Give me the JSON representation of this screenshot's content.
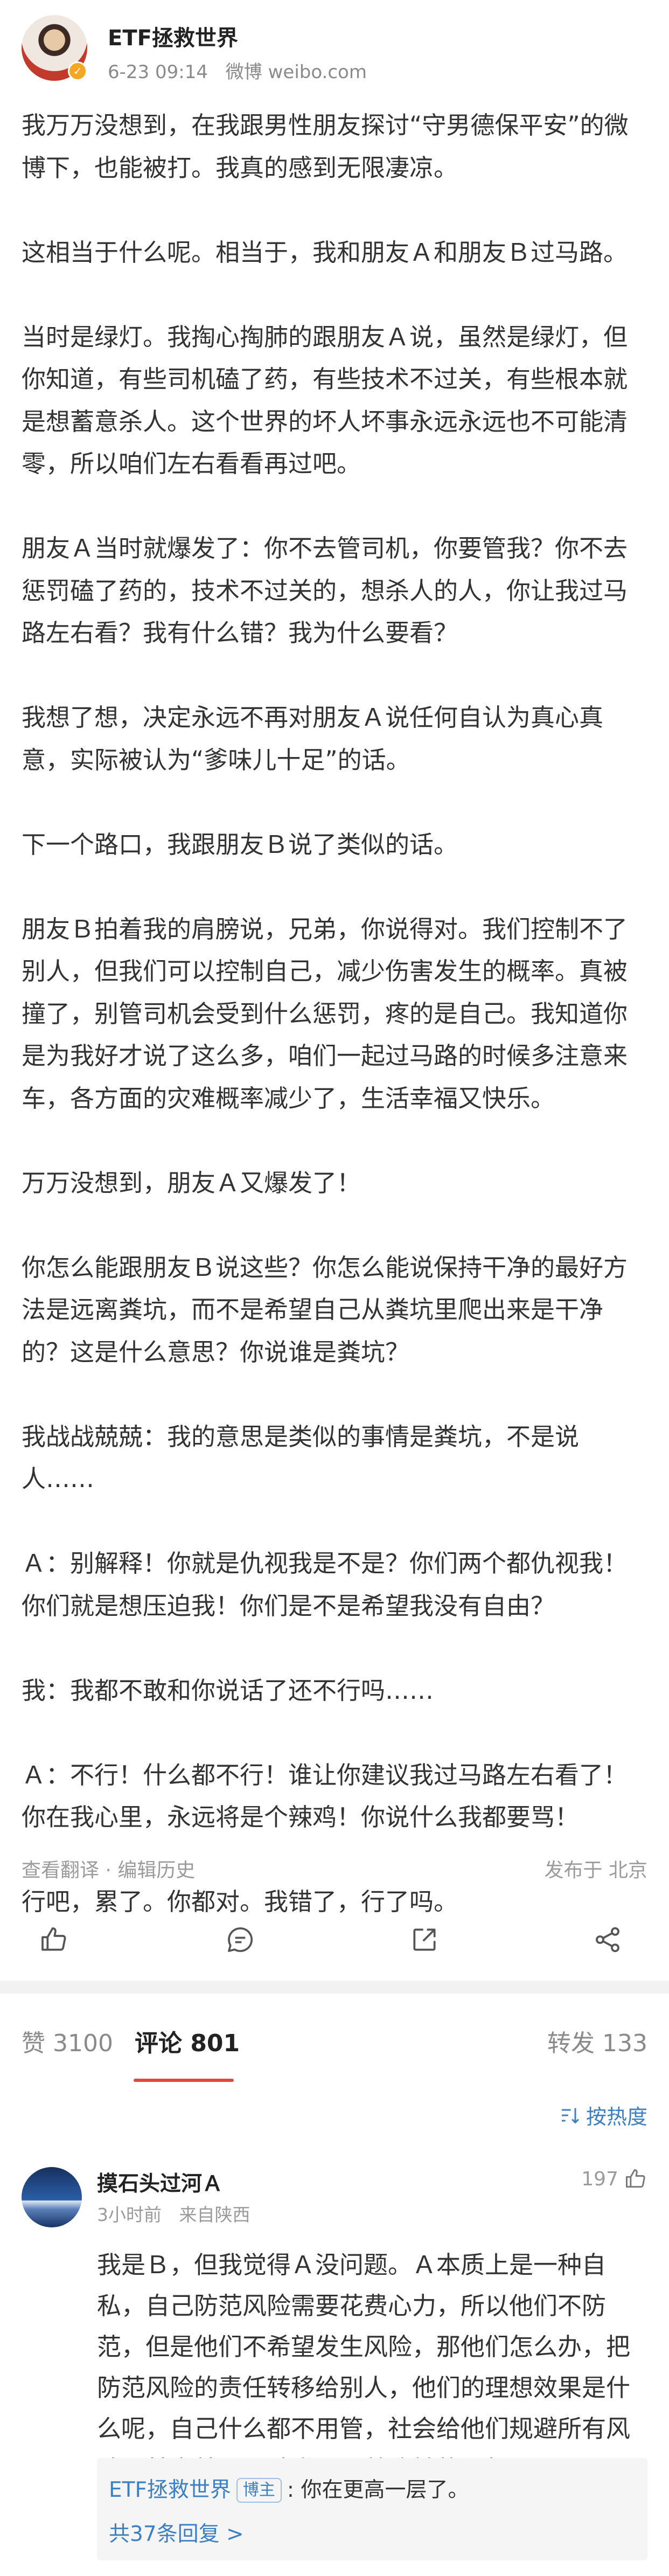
{
  "post": {
    "author": "ETF拯救世界",
    "time": "6-23 09:14",
    "source": "微博 weibo.com",
    "paragraphs": [
      "我万万没想到，在我跟男性朋友探讨“守男德保平安”的微博下，也能被打。我真的感到无限凄凉。",
      "这相当于什么呢。相当于，我和朋友Ａ和朋友Ｂ过马路。",
      "当时是绿灯。我掏心掏肺的跟朋友Ａ说，虽然是绿灯，但你知道，有些司机磕了药，有些技术不过关，有些根本就是想蓄意杀人。这个世界的坏人坏事永远永远也不可能清零，所以咱们左右看看再过吧。",
      "朋友Ａ当时就爆发了：你不去管司机，你要管我？你不去惩罚磕了药的，技术不过关的，想杀人的人，你让我过马路左右看？我有什么错？我为什么要看？",
      "我想了想，决定永远不再对朋友Ａ说任何自认为真心真意，实际被认为“爹味儿十足”的话。",
      "下一个路口，我跟朋友Ｂ说了类似的话。",
      "朋友Ｂ拍着我的肩膀说，兄弟，你说得对。我们控制不了别人，但我们可以控制自己，减少伤害发生的概率。真被撞了，别管司机会受到什么惩罚，疼的是自己。我知道你是为我好才说了这么多，咱们一起过马路的时候多注意来车，各方面的灾难概率减少了，生活幸福又快乐。",
      "万万没想到，朋友Ａ又爆发了！",
      "你怎么能跟朋友Ｂ说这些？你怎么能说保持干净的最好方法是远离粪坑，而不是希望自己从粪坑里爬出来是干净的？这是什么意思？你说谁是粪坑？",
      "我战战兢兢：我的意思是类似的事情是粪坑，不是说人……",
      "Ａ：别解释！你就是仇视我是不是？你们两个都仇视我！你们就是想压迫我！你们是不是希望我没有自由？",
      "我：我都不敢和你说话了还不行吗……",
      "Ａ：不行！什么都不行！谁让你建议我过马路左右看了！你在我心里，永远将是个辣鸡！你说什么我都要骂！",
      "行吧，累了。你都对。我错了，行了吗。"
    ],
    "footer_left": "查看翻译 · 编辑历史",
    "footer_right": "发布于 北京"
  },
  "actions": {
    "icons": [
      "thumb-up-icon",
      "comment-icon",
      "share-icon",
      "network-icon"
    ]
  },
  "tabs": {
    "likes": "赞 3100",
    "comments": "评论 801",
    "reposts": "转发 133"
  },
  "sort_label": "按热度",
  "comment": {
    "name": "摸石头过河Ａ",
    "time": "3小时前",
    "location": "来自陕西",
    "likes": "197",
    "text": "我是Ｂ，但我觉得Ａ没问题。Ａ本质上是一种自私，自己防范风险需要花费心力，所以他们不防范，但是他们不希望发生风险，那他们怎么办，把防范风险的责任转移给别人，他们的理想效果是什么呢，自己什么都不用管，社会给他们规避所有风险，其实就是一种世界围着我转的思想。",
    "reply": {
      "author": "ETF拯救世界",
      "tag": "博主",
      "text": ": 你在更高一层了。",
      "more": "共37条回复 >"
    }
  },
  "colors": {
    "accent_blue": "#3b7fc4",
    "tab_underline": "#e0483e",
    "muted": "#9b9b9b"
  }
}
